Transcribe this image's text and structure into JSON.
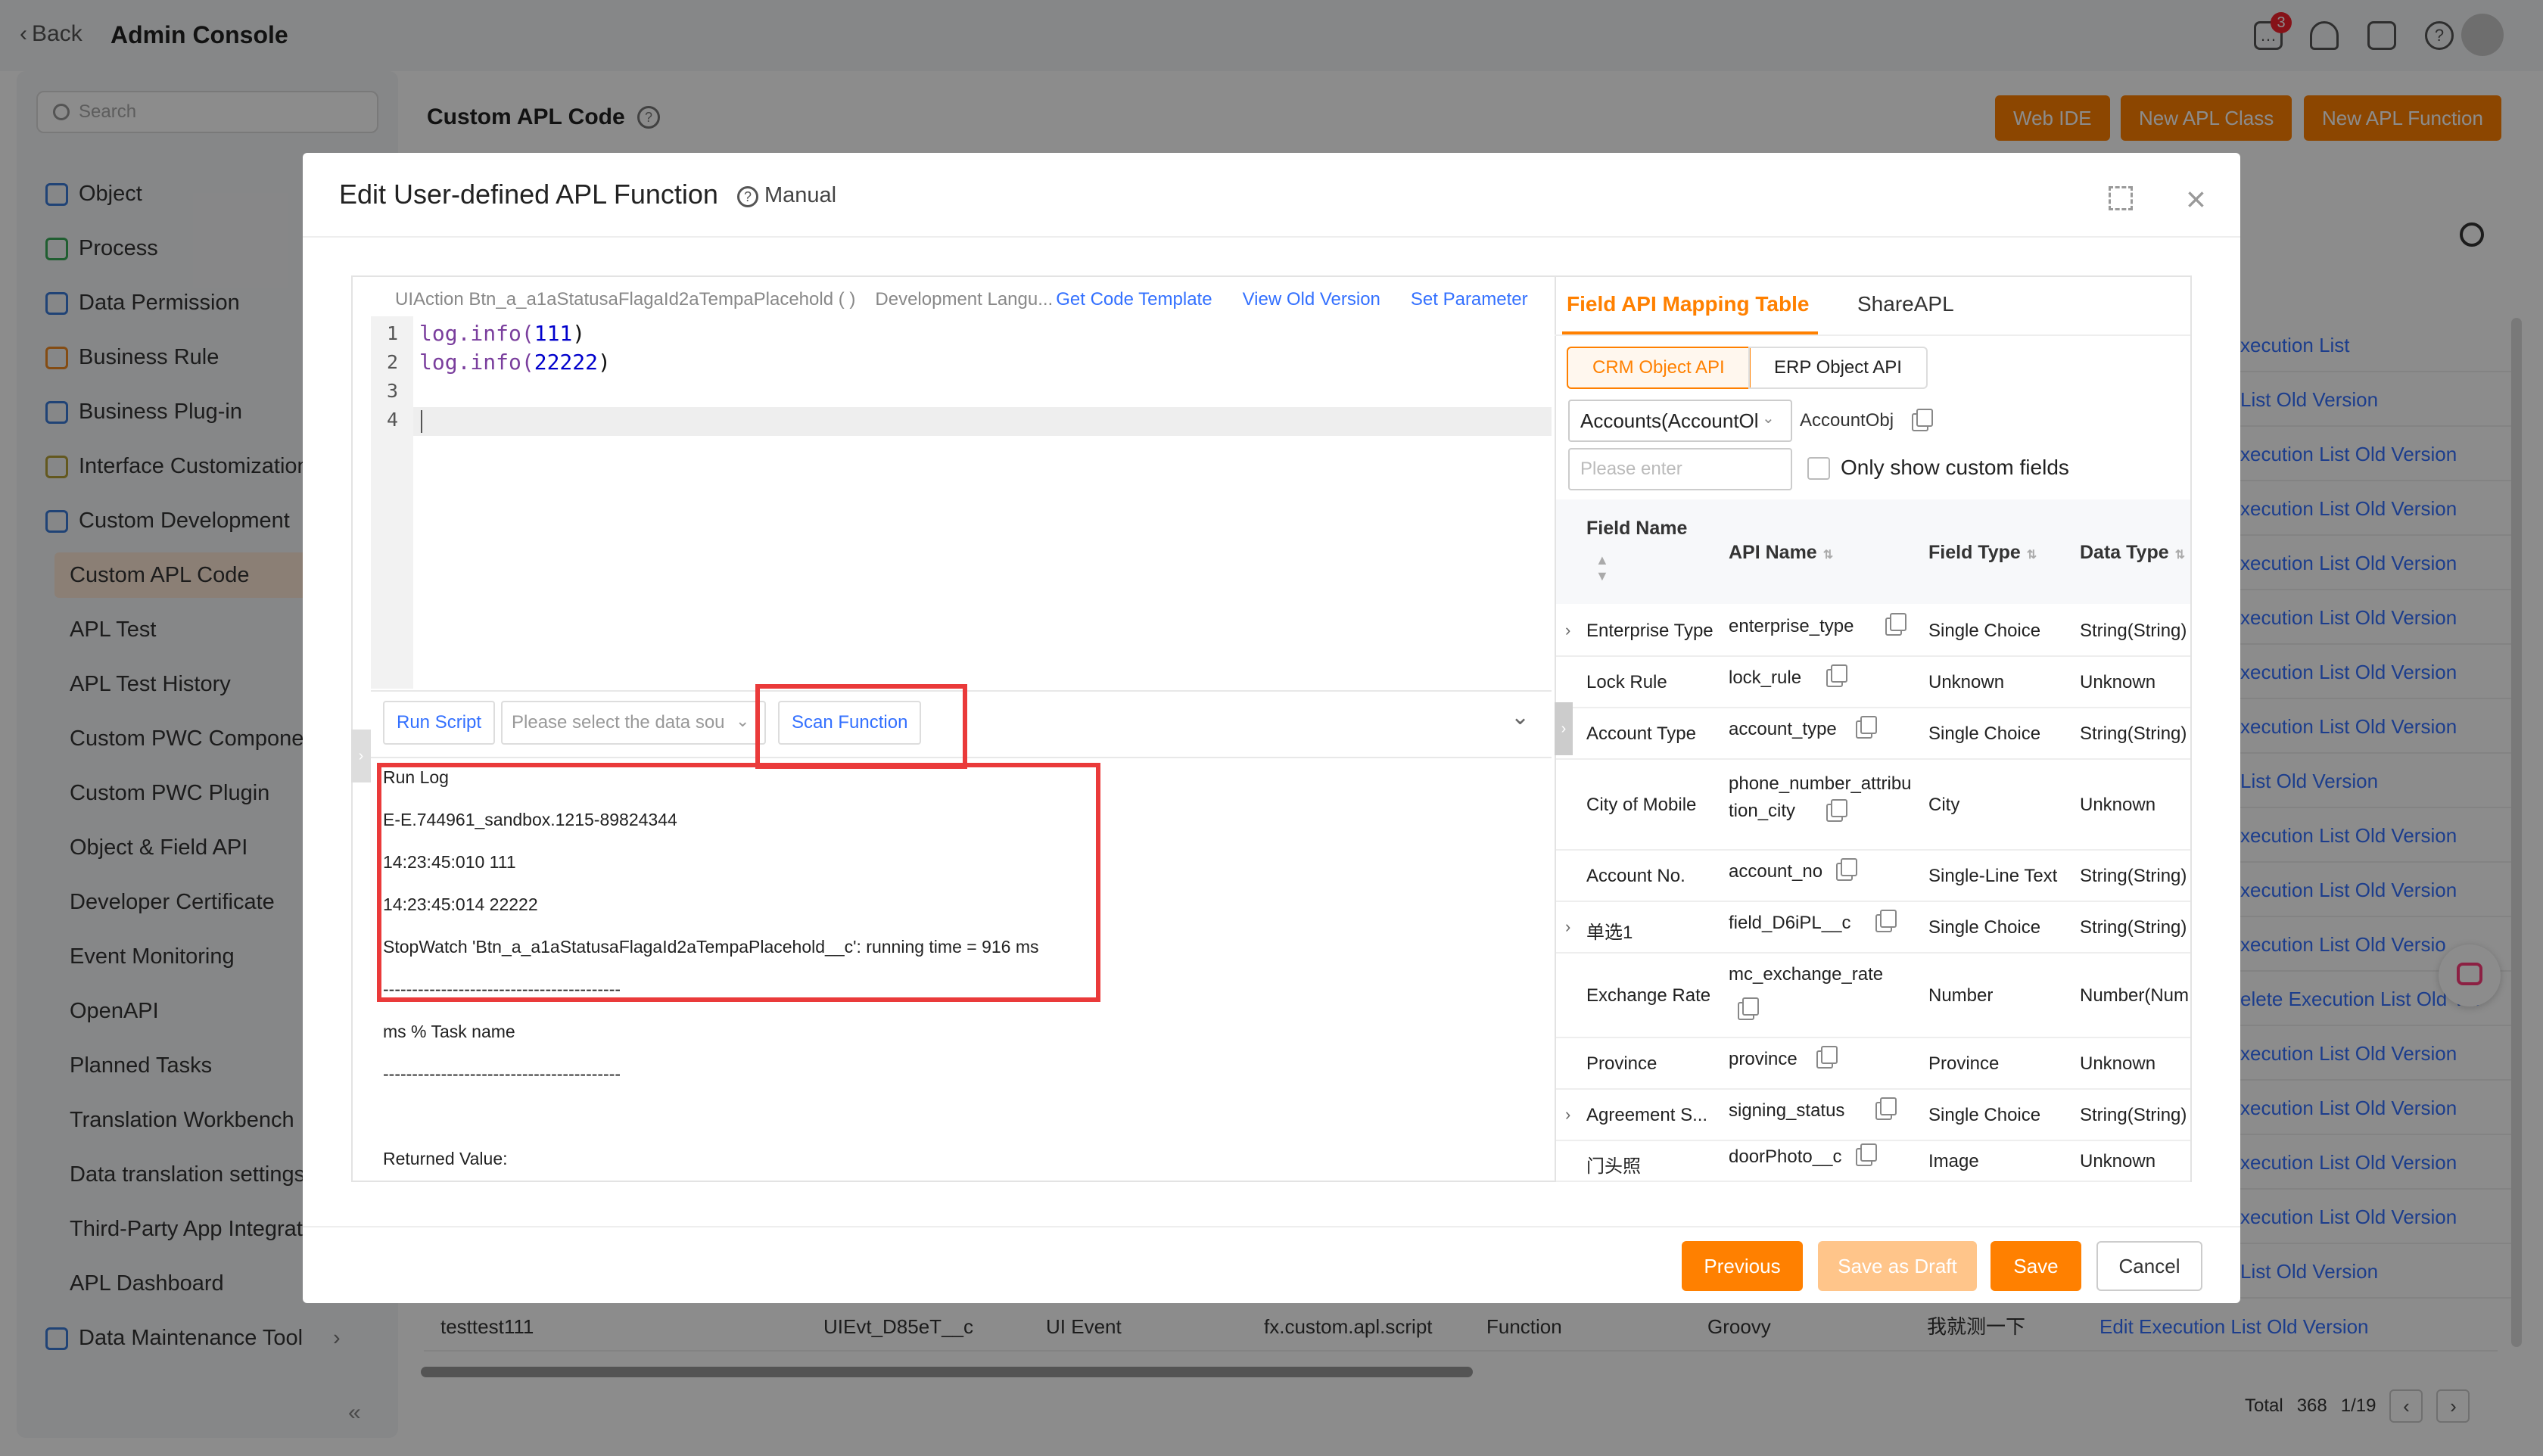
{
  "topbar": {
    "back_label": "Back",
    "app_title": "Admin Console",
    "message_count": "3"
  },
  "sidebar": {
    "search_placeholder": "Search",
    "items": [
      {
        "label": "Object",
        "icon": "cube-icon"
      },
      {
        "label": "Process",
        "icon": "process-icon"
      },
      {
        "label": "Data Permission",
        "icon": "permission-icon"
      },
      {
        "label": "Business Rule",
        "icon": "rule-icon"
      },
      {
        "label": "Business Plug-in",
        "icon": "plugin-icon"
      },
      {
        "label": "Interface Customization",
        "icon": "interface-icon"
      },
      {
        "label": "Custom Development",
        "icon": "code-icon"
      }
    ],
    "sub_items": [
      "Custom APL Code",
      "APL Test",
      "APL Test History",
      "Custom PWC Componer",
      "Custom PWC Plugin",
      "Object & Field API",
      "Developer Certificate",
      "Event Monitoring",
      "OpenAPI",
      "Planned Tasks",
      "Translation Workbench",
      "Data translation settings",
      "Third-Party App Integratio",
      "APL Dashboard"
    ],
    "maintenance": "Data Maintenance Tool"
  },
  "main": {
    "title": "Custom APL Code",
    "buttons": [
      "Web IDE",
      "New APL Class",
      "New APL Function"
    ],
    "rows": [
      "xecution List",
      "List  Old Version",
      "xecution List  Old Version",
      "xecution List  Old Version",
      "xecution List  Old Version",
      "xecution List  Old Version",
      "xecution List  Old Version",
      "xecution List  Old Version",
      "List  Old Version",
      "xecution List  Old Version",
      "xecution List  Old Version",
      "xecution List  Old Versio",
      "elete  Execution List  Old V...",
      "xecution List  Old Version",
      "xecution List  Old Version",
      "xecution List  Old Version",
      "xecution List  Old Version",
      "List  Old Version"
    ],
    "bottom_row": {
      "name": "testtest111",
      "api": "UIEvt_D85eT__c",
      "type": "UI Event",
      "namespace": "fx.custom.apl.script",
      "kind": "Function",
      "lang": "Groovy",
      "remark": "我就测一下",
      "actions": "Edit  Execution List  Old Version"
    },
    "pager": {
      "total_label": "Total",
      "total": "368",
      "page": "1/19"
    }
  },
  "modal": {
    "title": "Edit User-defined APL Function",
    "manual": "Manual",
    "editor_header": {
      "action": "UIAction Btn_a_a1aStatusaFlagaId2aTempaPlacehold ( )",
      "lang": "Development Langu...",
      "links": [
        "Get Code Template",
        "View Old Version",
        "Set Parameter"
      ]
    },
    "code": {
      "line_numbers": [
        "1",
        "2",
        "3",
        "4"
      ],
      "lines": [
        {
          "fn": "log.info(",
          "num": "111",
          "end": ")"
        },
        {
          "fn": "log.info(",
          "num": "22222",
          "end": ")"
        }
      ]
    },
    "toolbar": {
      "run": "Run Script",
      "data_placeholder": "Please select the data sou",
      "scan": "Scan Function"
    },
    "log": [
      "Run Log",
      "E-E.744961_sandbox.1215-89824344",
      "14:23:45:010 111",
      "14:23:45:014 22222",
      "StopWatch 'Btn_a_a1aStatusaFlagaId2aTempaPlacehold__c': running time = 916 ms",
      "-----------------------------------------",
      "ms % Task name",
      "-----------------------------------------",
      "",
      "Returned Value:"
    ],
    "right": {
      "tabs": [
        "Field API Mapping Table",
        "ShareAPL"
      ],
      "segments": [
        "CRM Object API",
        "ERP Object API"
      ],
      "object_select": "Accounts(AccountOl",
      "object_api": "AccountObj",
      "search_placeholder": "Please enter",
      "only_custom": "Only show custom fields",
      "columns": [
        "Field Name",
        "API Name",
        "Field Type",
        "Data Type"
      ],
      "rows": [
        {
          "name": "Enterprise Type",
          "api": "enterprise_type",
          "ftype": "Single Choice",
          "dtype": "String(String)"
        },
        {
          "name": "Lock Rule",
          "api": "lock_rule",
          "ftype": "Unknown",
          "dtype": "Unknown"
        },
        {
          "name": "Account Type",
          "api": "account_type",
          "ftype": "Single Choice",
          "dtype": "String(String)"
        },
        {
          "name": "City of Mobile",
          "api": "phone_number_attribu",
          "api2": "tion_city",
          "ftype": "City",
          "dtype": "Unknown"
        },
        {
          "name": "Account No.",
          "api": "account_no",
          "ftype": "Single-Line Text",
          "dtype": "String(String)"
        },
        {
          "name": "单选1",
          "api": "field_D6iPL__c",
          "ftype": "Single Choice",
          "dtype": "String(String)"
        },
        {
          "name": "Exchange Rate",
          "api": "mc_exchange_rate",
          "ftype": "Number",
          "dtype": "Number(Num"
        },
        {
          "name": "Province",
          "api": "province",
          "ftype": "Province",
          "dtype": "Unknown"
        },
        {
          "name": "Agreement S...",
          "api": "signing_status",
          "ftype": "Single Choice",
          "dtype": "String(String)"
        },
        {
          "name": "门头照",
          "api": "doorPhoto__c",
          "ftype": "Image",
          "dtype": "Unknown"
        }
      ]
    },
    "footer": {
      "previous": "Previous",
      "draft": "Save as Draft",
      "save": "Save",
      "cancel": "Cancel"
    }
  },
  "colors": {
    "accent": "#ff8000",
    "link": "#3370ff",
    "highlight_box": "#ea3a3a"
  }
}
